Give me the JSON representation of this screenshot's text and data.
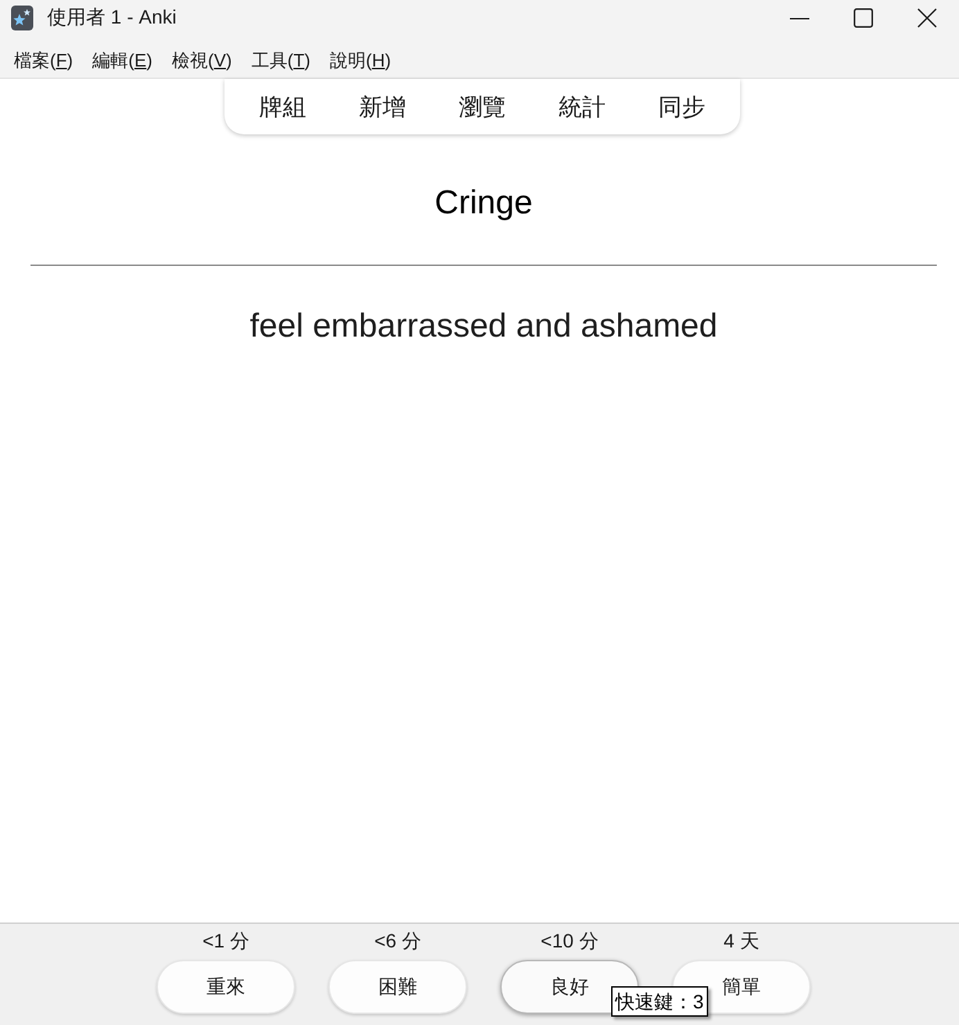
{
  "window": {
    "title": "使用者 1 - Anki"
  },
  "menu": [
    {
      "before": "檔案(",
      "mnemonic": "F",
      "after": ")"
    },
    {
      "before": "編輯(",
      "mnemonic": "E",
      "after": ")"
    },
    {
      "before": "檢視(",
      "mnemonic": "V",
      "after": ")"
    },
    {
      "before": "工具(",
      "mnemonic": "T",
      "after": ")"
    },
    {
      "before": "說明(",
      "mnemonic": "H",
      "after": ")"
    }
  ],
  "toolbar": [
    "牌組",
    "新增",
    "瀏覽",
    "統計",
    "同步"
  ],
  "card": {
    "front": "Cringe",
    "back": "feel embarrassed and ashamed"
  },
  "answer_buttons": [
    {
      "interval": "<1 分",
      "label": "重來",
      "hovered": false
    },
    {
      "interval": "<6 分",
      "label": "困難",
      "hovered": false
    },
    {
      "interval": "<10 分",
      "label": "良好",
      "hovered": true
    },
    {
      "interval": "4 天",
      "label": "簡單",
      "hovered": false
    }
  ],
  "tooltip": {
    "text": "快速鍵：3"
  }
}
